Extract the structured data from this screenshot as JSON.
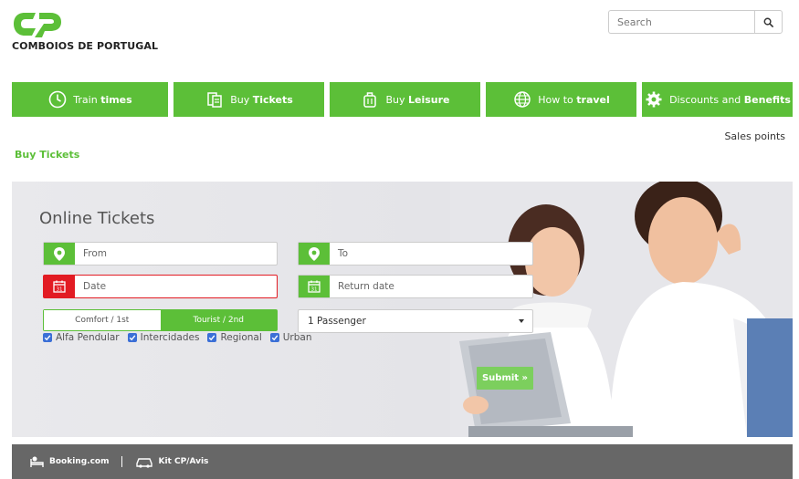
{
  "header": {
    "logo_text": "COMBOIOS DE PORTUGAL",
    "search_placeholder": "Search"
  },
  "nav": [
    {
      "pre": "Train ",
      "bold": "times",
      "icon": "clock-icon"
    },
    {
      "pre": "Buy ",
      "bold": "Tickets",
      "icon": "tickets-icon"
    },
    {
      "pre": "Buy ",
      "bold": "Leisure",
      "icon": "luggage-icon"
    },
    {
      "pre": "How to ",
      "bold": "travel",
      "icon": "globe-icon"
    },
    {
      "pre": "Discounts and ",
      "bold": "Benefits",
      "icon": "gear-icon"
    }
  ],
  "sales_points": "Sales points",
  "breadcrumb": "Buy Tickets",
  "form": {
    "title": "Online Tickets",
    "from_placeholder": "From",
    "to_placeholder": "To",
    "date_placeholder": "Date",
    "return_placeholder": "Return date",
    "class_options": [
      "Comfort / 1st",
      "Tourist / 2nd"
    ],
    "class_selected": "Tourist / 2nd",
    "passengers": "1 Passenger",
    "train_types": [
      "Alfa Pendular",
      "Intercidades",
      "Regional",
      "Urban"
    ],
    "submit": "Submit »"
  },
  "footer": {
    "booking": "Booking.com",
    "kit": "Kit CP/Avis"
  },
  "colors": {
    "brand_green": "#5cbf38",
    "error_red": "#e21b23",
    "footer_gray": "#676767"
  }
}
